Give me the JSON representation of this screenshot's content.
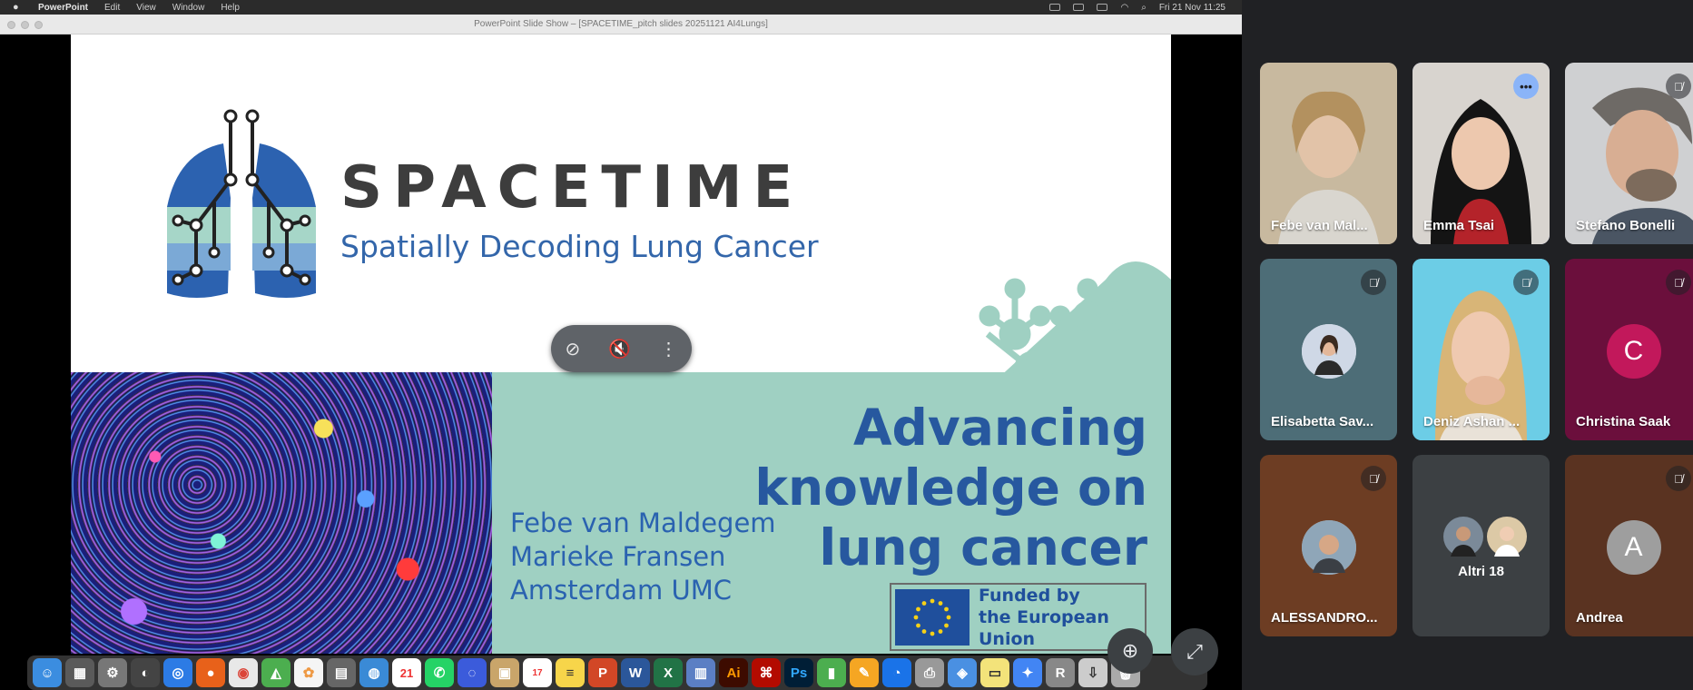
{
  "menubar": {
    "apple": "",
    "app": "PowerPoint",
    "items": [
      "Edit",
      "View",
      "Window",
      "Help"
    ],
    "clock": "Fri 21 Nov  11:25"
  },
  "window": {
    "title": "PowerPoint Slide Show – [SPACETIME_pitch slides 20251121 AI4Lungs]"
  },
  "slide": {
    "brand_title": "SPACETIME",
    "brand_subtitle": "Spatially Decoding Lung Cancer",
    "headline": [
      "Advancing",
      "knowledge on",
      "lung cancer"
    ],
    "authors": [
      "Febe van Maldegem",
      "Marieke Fransen",
      "Amsterdam UMC"
    ],
    "eu_text": [
      "Funded by",
      "the European Union"
    ]
  },
  "colors": {
    "brand_blue": "#27589f",
    "teal": "#9fd0c2",
    "speaking": "#8ab4f8"
  },
  "participants": [
    {
      "name": "Febe van Mal...",
      "state": "video",
      "muted": false
    },
    {
      "name": "Emma Tsai",
      "state": "video",
      "speaking": true
    },
    {
      "name": "Stefano Bonelli",
      "state": "video",
      "muted": true
    },
    {
      "name": "Elisabetta Sav...",
      "state": "avatar",
      "muted": true
    },
    {
      "name": "Deniz Ashan ...",
      "state": "video",
      "muted": true
    },
    {
      "name": "Christina Saak",
      "state": "letter",
      "letter": "C",
      "muted": true
    },
    {
      "name": "ALESSANDRO...",
      "state": "avatar",
      "muted": true
    },
    {
      "name": "Altri 18",
      "state": "group",
      "muted": false
    },
    {
      "name": "Andrea",
      "state": "letter",
      "letter": "A",
      "muted": true
    }
  ],
  "dock": {
    "calendar_day": "21",
    "badge_count": "17"
  }
}
